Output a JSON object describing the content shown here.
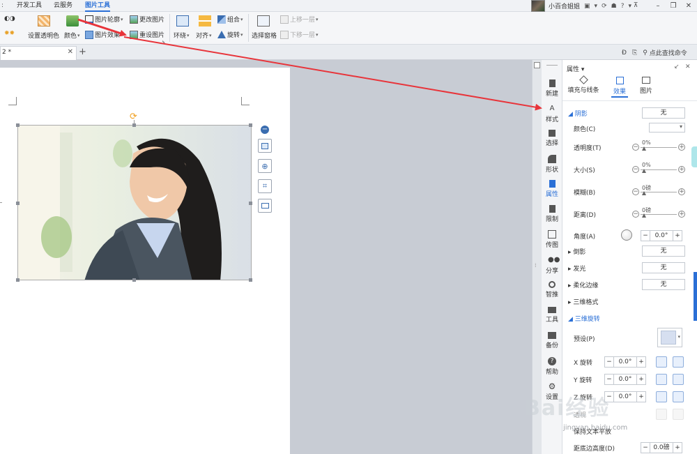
{
  "menubar": {
    "tabs": [
      {
        "label": "开发工具",
        "active": false
      },
      {
        "label": "云服务",
        "active": false
      },
      {
        "label": "图片工具",
        "active": true
      }
    ],
    "user_name": "小百合姐姐",
    "help_label": "?"
  },
  "ribbon": {
    "set_transparent": "设置透明色",
    "color": "颜色",
    "picture_outline": "图片轮廓",
    "picture_effect": "图片效果",
    "change_picture": "更改图片",
    "reset_picture": "重设图片",
    "wrap": "环绕",
    "align": "对齐",
    "group": "组合",
    "rotate": "旋转",
    "selection_pane": "选择窗格",
    "bring_forward": "上移一层",
    "send_backward": "下移一层"
  },
  "tabrow": {
    "doc_tab": "2 *",
    "command_search": "点此查找命令"
  },
  "nav": [
    {
      "label": "新建",
      "icon": "new-doc-icon"
    },
    {
      "label": "样式",
      "icon": "style-icon"
    },
    {
      "label": "选择",
      "icon": "select-icon"
    },
    {
      "label": "形状",
      "icon": "shape-icon"
    },
    {
      "label": "属性",
      "icon": "property-icon"
    },
    {
      "label": "限制",
      "icon": "restrict-icon"
    },
    {
      "label": "传图",
      "icon": "upload-image-icon"
    },
    {
      "label": "分享",
      "icon": "share-icon"
    },
    {
      "label": "智推",
      "icon": "smart-push-icon"
    },
    {
      "label": "工具",
      "icon": "toolbox-icon"
    },
    {
      "label": "备份",
      "icon": "backup-icon"
    },
    {
      "label": "帮助",
      "icon": "help-icon"
    },
    {
      "label": "设置",
      "icon": "gear-icon"
    }
  ],
  "panel": {
    "title": "属性",
    "tabs": [
      {
        "label": "填充与线条",
        "active": false
      },
      {
        "label": "效果",
        "active": true
      },
      {
        "label": "图片",
        "active": false
      }
    ],
    "shadow": {
      "section": "阴影",
      "value": "无",
      "color_label": "颜色(C)",
      "transparency_label": "透明度(T)",
      "transparency_value": "0%",
      "size_label": "大小(S)",
      "size_value": "0%",
      "blur_label": "模糊(B)",
      "blur_value": "0磅",
      "distance_label": "距离(D)",
      "distance_value": "0磅",
      "angle_label": "角度(A)",
      "angle_value": "0.0°"
    },
    "reflection": {
      "section": "倒影",
      "value": "无"
    },
    "glow": {
      "section": "发光",
      "value": "无"
    },
    "soft_edge": {
      "section": "柔化边缘",
      "value": "无"
    },
    "three_d_format": {
      "section": "三维格式"
    },
    "three_d_rotation": {
      "section": "三维旋转",
      "preset_label": "预设(P)",
      "x_label": "X 旋转",
      "x_value": "0.0°",
      "y_label": "Y 旋转",
      "y_value": "0.0°",
      "z_label": "Z 旋转",
      "z_value": "0.0°",
      "keep_text_flat": "保持文本平放",
      "distance_bottom_label": "距底边高度(D)",
      "distance_bottom_value": "0.0磅"
    }
  },
  "watermark": "Bai经验",
  "watermark_sub": "jingyan.baidu.com",
  "colors": {
    "accent": "#2a6fd6",
    "arrow": "#e8343a",
    "canvas": "#c8ccd4"
  }
}
